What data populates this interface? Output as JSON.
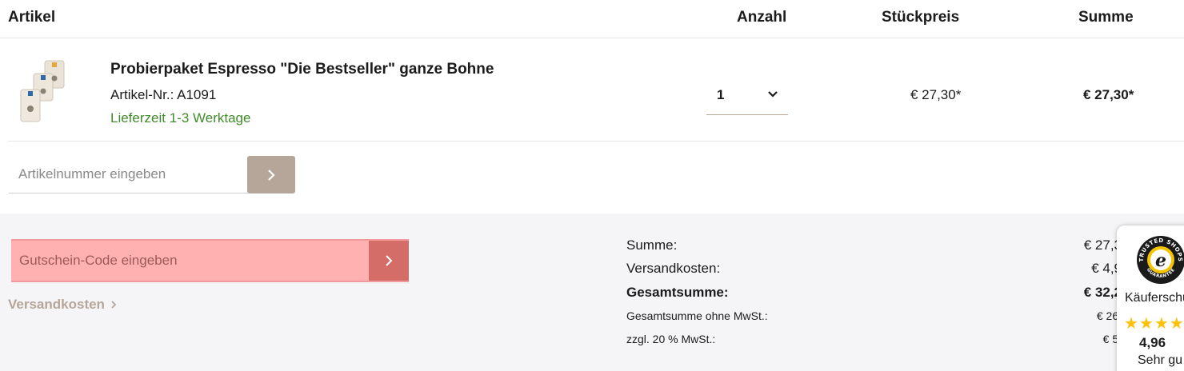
{
  "table_header": {
    "article": "Artikel",
    "quantity": "Anzahl",
    "unit_price": "Stückpreis",
    "total": "Summe"
  },
  "item": {
    "name": "Probierpaket Espresso \"Die Bestseller\" ganze Bohne",
    "article_number": "Artikel-Nr.: A1091",
    "delivery": "Lieferzeit 1-3 Werktage",
    "quantity": "1",
    "unit_price": "€ 27,30*",
    "total_price": "€ 27,30*"
  },
  "add_article": {
    "placeholder": "Artikelnummer eingeben"
  },
  "voucher": {
    "placeholder": "Gutschein-Code eingeben"
  },
  "shipping_link": "Versandkosten",
  "summary": {
    "subtotal_label": "Summe:",
    "subtotal_value": "€ 27,3",
    "shipping_label": "Versandkosten:",
    "shipping_value": "€ 4,9",
    "grand_total_label": "Gesamtsumme:",
    "grand_total_value": "€ 32,2",
    "net_label": "Gesamtsumme ohne MwSt.:",
    "net_value": "€ 26,",
    "vat_label": "zzgl. 20 % MwSt.:",
    "vat_value": "€ 5,"
  },
  "trusted_shops": {
    "seal_top_text": "TRUSTED SHOPS",
    "seal_bottom_text": "GUARANTEE",
    "label": "Käuferschu",
    "stars": "★★★★",
    "rating": "4,96",
    "rating_text": "Sehr gu"
  },
  "colors": {
    "accent": "#b5a699",
    "delivery_green": "#3f8b2a",
    "voucher_highlight": "#ffb1b1",
    "voucher_button": "#d46d67",
    "star": "#ffc107"
  }
}
